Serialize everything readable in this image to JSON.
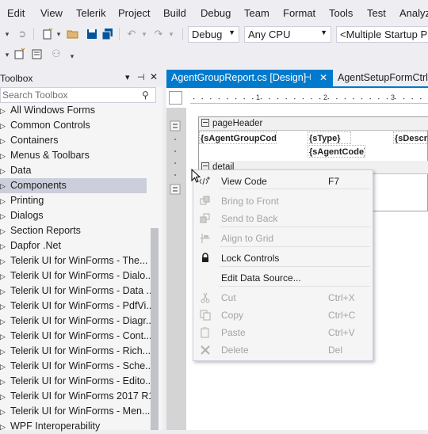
{
  "menu": [
    "Edit",
    "View",
    "Telerik",
    "Project",
    "Build",
    "Debug",
    "Team",
    "Format",
    "Tools",
    "Test",
    "Analyze"
  ],
  "toolbar": {
    "config": "Debug",
    "platform": "Any CPU",
    "startup": "<Multiple Startup Projects>"
  },
  "toolbox": {
    "title": "Toolbox",
    "pin_glyph": "▾ ⊣ ✕",
    "search_placeholder": "Search Toolbox",
    "items": [
      "All Windows Forms",
      "Common Controls",
      "Containers",
      "Menus & Toolbars",
      "Data",
      "Components",
      "Printing",
      "Dialogs",
      "Section Reports",
      "Dapfor .Net",
      "Telerik UI for WinForms - The...",
      "Telerik UI for WinForms - Dialo...",
      "Telerik UI for WinForms - Data ...",
      "Telerik UI for WinForms - PdfVi...",
      "Telerik UI for WinForms - Diagr...",
      "Telerik UI for WinForms - Cont...",
      "Telerik UI for WinForms - Rich...",
      "Telerik UI for WinForms - Sche...",
      "Telerik UI for WinForms - Edito...",
      "Telerik UI for WinForms 2017 R1",
      "Telerik UI for WinForms - Men...",
      "WPF Interoperability"
    ],
    "selected_index": 5
  },
  "tabs": {
    "active": "AgentGroupReport.cs [Design]",
    "inactive": "AgentSetupFormCtrl.cs"
  },
  "ruler": [
    "1",
    "2",
    "3"
  ],
  "report": {
    "page_header": "pageHeader",
    "detail": "detail",
    "fields": [
      "{sAgentGroupCode}",
      "{sType}",
      "{sDescri",
      "{sAgentCode}"
    ]
  },
  "context_menu": {
    "items": [
      {
        "label": "View Code",
        "shortcut": "F7",
        "icon": "view-code-icon",
        "enabled": true
      },
      {
        "label": "Bring to Front",
        "shortcut": "",
        "icon": "bring-to-front-icon",
        "enabled": false
      },
      {
        "label": "Send to Back",
        "shortcut": "",
        "icon": "send-to-back-icon",
        "enabled": false
      },
      {
        "label": "Align to Grid",
        "shortcut": "",
        "icon": "align-to-grid-icon",
        "enabled": false
      },
      {
        "label": "Lock Controls",
        "shortcut": "",
        "icon": "lock-icon",
        "enabled": true
      },
      {
        "label": "Edit Data Source...",
        "shortcut": "",
        "icon": "",
        "enabled": true
      },
      {
        "label": "Cut",
        "shortcut": "Ctrl+X",
        "icon": "cut-icon",
        "enabled": false
      },
      {
        "label": "Copy",
        "shortcut": "Ctrl+C",
        "icon": "copy-icon",
        "enabled": false
      },
      {
        "label": "Paste",
        "shortcut": "Ctrl+V",
        "icon": "paste-icon",
        "enabled": false
      },
      {
        "label": "Delete",
        "shortcut": "Del",
        "icon": "delete-icon",
        "enabled": false
      }
    ]
  },
  "colors": {
    "accent": "#007acc",
    "chrome": "#eeeef2",
    "disabled_text": "#a2a4a5"
  }
}
